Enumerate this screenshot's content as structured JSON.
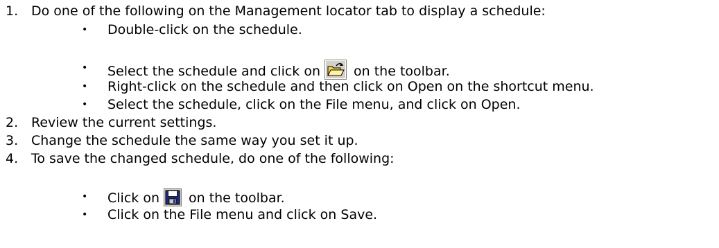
{
  "steps": [
    {
      "number": "1.",
      "text": "Do one of the following on the Management locator tab to display a schedule:",
      "bullets": [
        {
          "text": "Double-click on the schedule."
        },
        {
          "before": "Select the schedule and click on",
          "icon": "open-folder-icon",
          "after": "on the toolbar."
        },
        {
          "text": "Right-click on the schedule and then click on Open on the shortcut menu."
        },
        {
          "text": "Select the schedule, click on the File menu, and click on Open."
        }
      ]
    },
    {
      "number": "2.",
      "text": "Review the current settings."
    },
    {
      "number": "3.",
      "text": "Change the schedule the same way you set it up."
    },
    {
      "number": "4.",
      "text": "To save the changed schedule, do one of the following:",
      "bullets": [
        {
          "before": "Click on",
          "icon": "save-disk-icon",
          "after": "on the toolbar."
        },
        {
          "text": "Click on the File menu and click on Save."
        }
      ]
    }
  ],
  "bullet_glyph": "•"
}
